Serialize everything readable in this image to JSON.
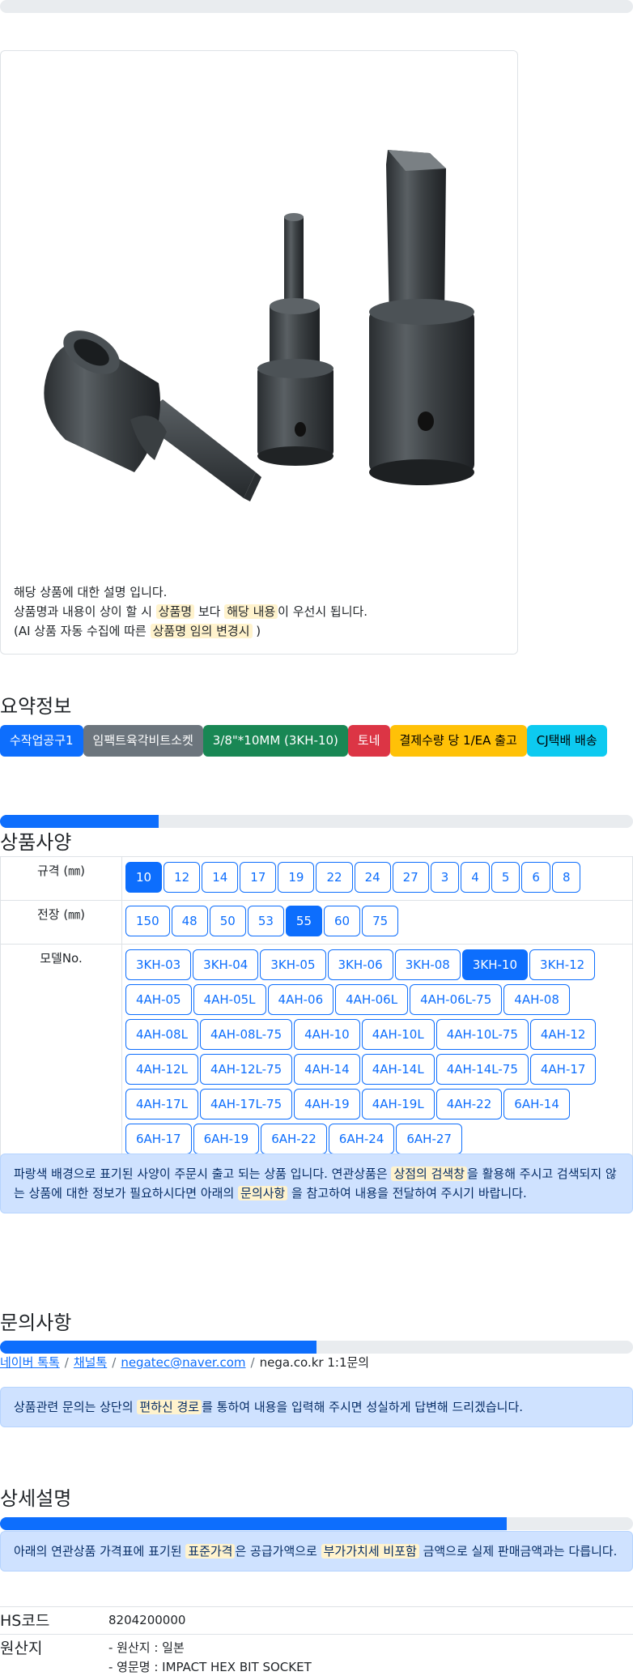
{
  "product": {
    "notes": {
      "line1": "해당 상품에 대한 설명 입니다.",
      "line2_pre": "상품명과 내용이 상이 할 시 ",
      "line2_hl1": "상품명",
      "line2_mid": " 보다 ",
      "line2_hl2": "해당 내용",
      "line2_post": "이 우선시 됩니다.",
      "line3_pre": "(AI 상품 자동 수집에 따른 ",
      "line3_hl": "상품명 임의 변경시",
      "line3_post": " )"
    }
  },
  "summary": {
    "title": "요약정보",
    "tags": [
      {
        "label": "수작업공구1",
        "color": "#0d6efd",
        "text_color": "#ffffff"
      },
      {
        "label": "임팩트육각비트소켓",
        "color": "#6c757d",
        "text_color": "#ffffff"
      },
      {
        "label": "3/8\"*10MM (3KH-10)",
        "color": "#198754",
        "text_color": "#ffffff"
      },
      {
        "label": "토네",
        "color": "#dc3545",
        "text_color": "#ffffff"
      },
      {
        "label": "결제수량 당 1/EA 출고",
        "color": "#ffc107",
        "text_color": "#000000"
      },
      {
        "label": "CJ택배 배송",
        "color": "#0dcaf0",
        "text_color": "#000000"
      }
    ]
  },
  "specs": {
    "title": "상품사양",
    "progress": 0.25,
    "rows": [
      {
        "label": "규격 (㎜)",
        "options": [
          "10",
          "12",
          "14",
          "17",
          "19",
          "22",
          "24",
          "27",
          "3",
          "4",
          "5",
          "6",
          "8"
        ],
        "selected": "10"
      },
      {
        "label": "전장 (㎜)",
        "options": [
          "150",
          "48",
          "50",
          "53",
          "55",
          "60",
          "75"
        ],
        "selected": "55"
      },
      {
        "label": "모델No.",
        "options": [
          "3KH-03",
          "3KH-04",
          "3KH-05",
          "3KH-06",
          "3KH-08",
          "3KH-10",
          "3KH-12",
          "4AH-05",
          "4AH-05L",
          "4AH-06",
          "4AH-06L",
          "4AH-06L-75",
          "4AH-08",
          "4AH-08L",
          "4AH-08L-75",
          "4AH-10",
          "4AH-10L",
          "4AH-10L-75",
          "4AH-12",
          "4AH-12L",
          "4AH-12L-75",
          "4AH-14",
          "4AH-14L",
          "4AH-14L-75",
          "4AH-17",
          "4AH-17L",
          "4AH-17L-75",
          "4AH-19",
          "4AH-19L",
          "4AH-22",
          "6AH-14",
          "6AH-17",
          "6AH-19",
          "6AH-22",
          "6AH-24",
          "6AH-27"
        ],
        "selected": "3KH-10"
      }
    ],
    "notice": {
      "pre": "파랑색 배경으로 표기된 사양이 주문시 출고 되는 상품 입니다. 연관상품은 ",
      "hl1": "상점의 검색창",
      "mid": "을 활용해 주시고 검색되지 않는 상품에 대한 정보가 필요하시다면 아래의 ",
      "hl2": "문의사항",
      "post": " 을 참고하여 내용을 전달하여 주시기 바랍니다."
    }
  },
  "inquiry": {
    "title": "문의사항",
    "progress": 0.5,
    "links": [
      "네이버 톡톡",
      "채널톡",
      "negatec@naver.com"
    ],
    "last": "nega.co.kr 1:1문의",
    "notice": {
      "pre": "상품관련 문의는 상단의 ",
      "hl": "편하신 경로",
      "post": "를 통하여 내용을 입력해 주시면 성실하게 답변해 드리겠습니다."
    }
  },
  "detail": {
    "title": "상세설명",
    "progress": 0.8,
    "notice": {
      "pre": "아래의 연관상품 가격표에 표기된 ",
      "hl1": "표준가격",
      "mid": "은 공급가액으로 ",
      "hl2": "부가가치세 비포함",
      "post": " 금액으로 실제 판매금액과는 다릅니다."
    },
    "hs_label": "HS코드",
    "hs_value": "8204200000",
    "origin_label": "원산지",
    "origin_line1": "- 원산지 : 일본",
    "origin_line2": "- 영문명 : IMPACT HEX BIT SOCKET"
  }
}
